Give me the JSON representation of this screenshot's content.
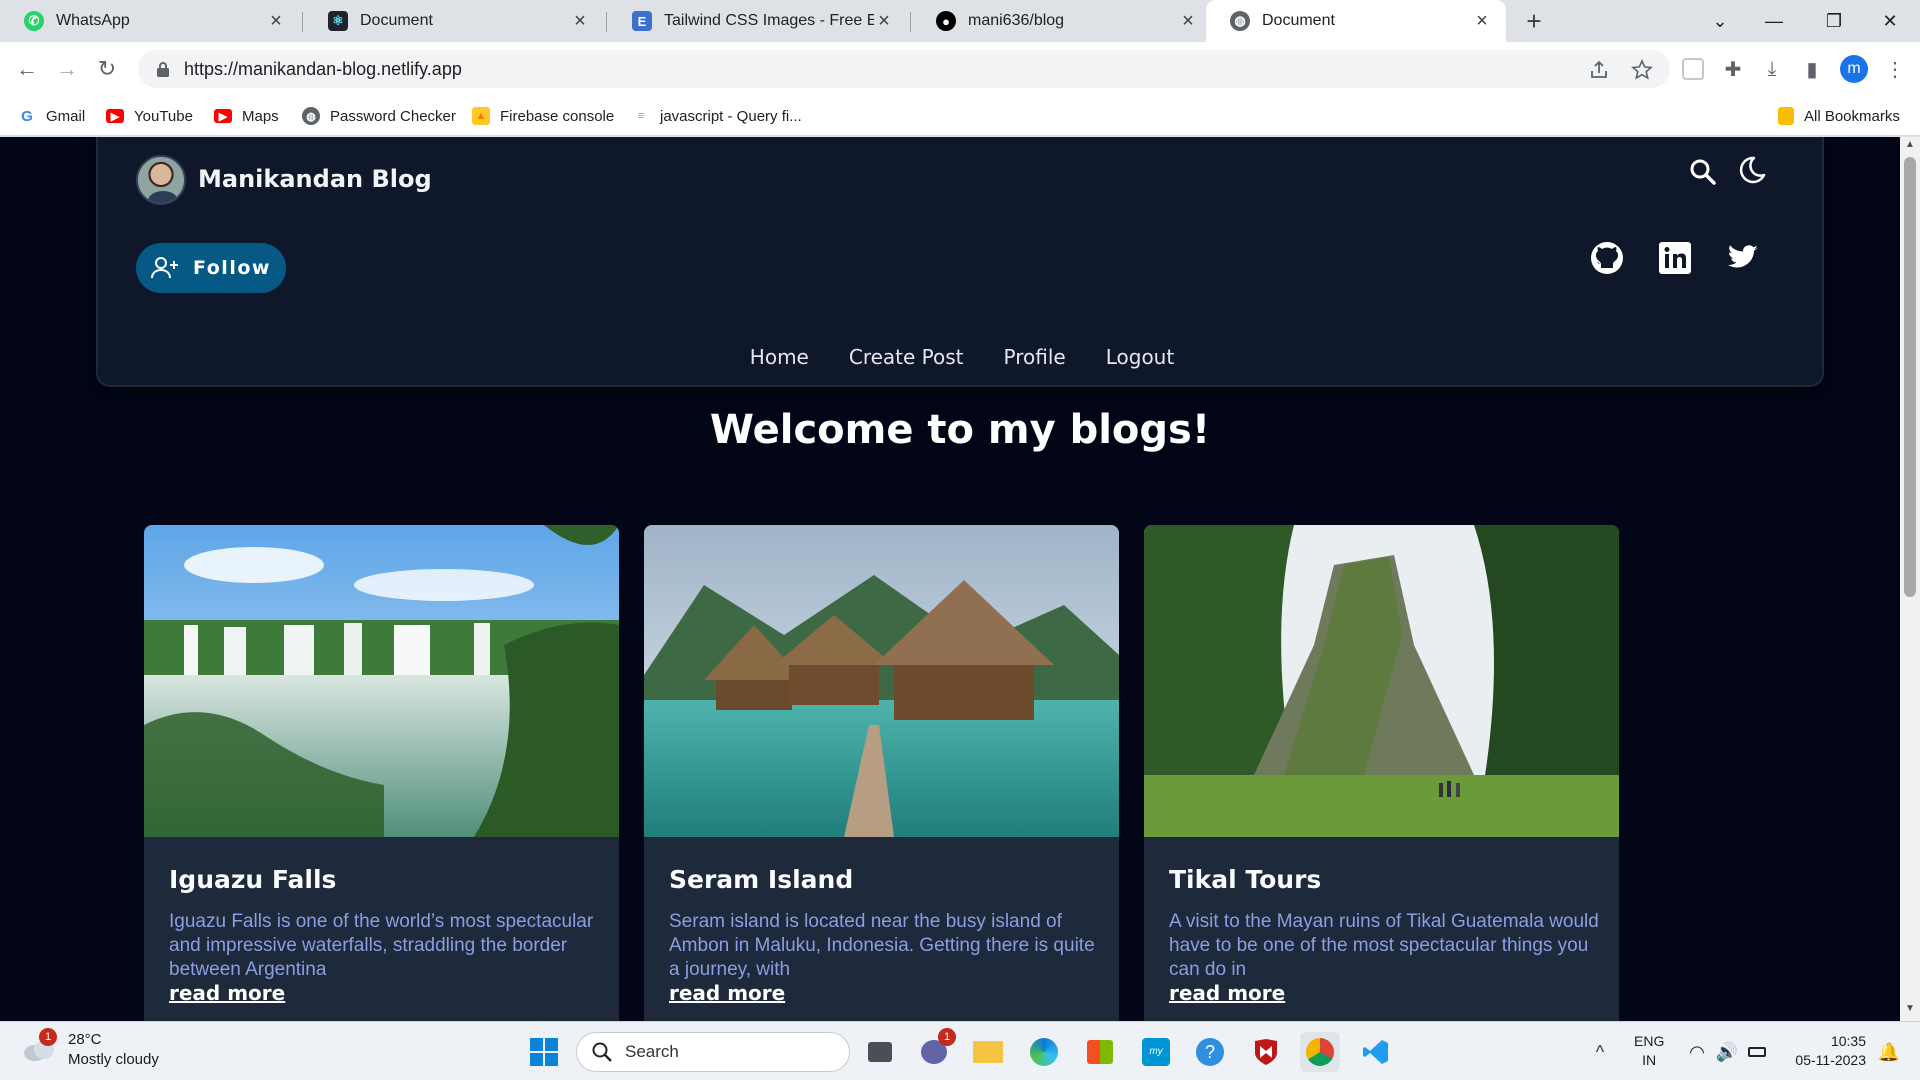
{
  "browser": {
    "tabs": [
      {
        "title": "WhatsApp",
        "icon": "whatsapp-icon"
      },
      {
        "title": "Document",
        "icon": "react-icon"
      },
      {
        "title": "Tailwind CSS Images - Free Exam",
        "icon": "tailwind-elements-icon"
      },
      {
        "title": "mani636/blog",
        "icon": "github-icon"
      },
      {
        "title": "Document",
        "icon": "globe-icon"
      }
    ],
    "url": "https://manikandan-blog.netlify.app",
    "profile_initial": "m",
    "bookmarks": [
      "Gmail",
      "YouTube",
      "Maps",
      "Password Checker",
      "Firebase console",
      "javascript - Query fi..."
    ],
    "all_bookmarks": "All Bookmarks"
  },
  "site": {
    "brand": "Manikandan Blog",
    "follow_label": "Follow",
    "nav": [
      "Home",
      "Create Post",
      "Profile",
      "Logout"
    ],
    "welcome": "Welcome to my blogs!",
    "colors": {
      "background": "#020617",
      "header": "#0f172a",
      "card": "#1e293b",
      "follow": "#075985",
      "excerpt": "#8b9ee0"
    },
    "posts": [
      {
        "title": "Iguazu Falls",
        "excerpt": "Iguazu Falls is one of the world’s most spectacular and impressive waterfalls, straddling the border between Argentina",
        "link": "read more"
      },
      {
        "title": "Seram Island",
        "excerpt": "Seram island is located near the busy island of Ambon in Maluku, Indonesia. Getting there is quite a journey, with",
        "link": "read more"
      },
      {
        "title": "Tikal Tours",
        "excerpt": "A visit to the Mayan ruins of Tikal Guatemala would have to be one of the most spectacular things you can do in",
        "link": "read more"
      }
    ]
  },
  "taskbar": {
    "temperature": "28°C",
    "weather": "Mostly cloudy",
    "weather_badge": "1",
    "search_label": "Search",
    "teams_badge": "1",
    "lang_top": "ENG",
    "lang_bottom": "IN",
    "time": "10:35",
    "date": "05-11-2023"
  }
}
